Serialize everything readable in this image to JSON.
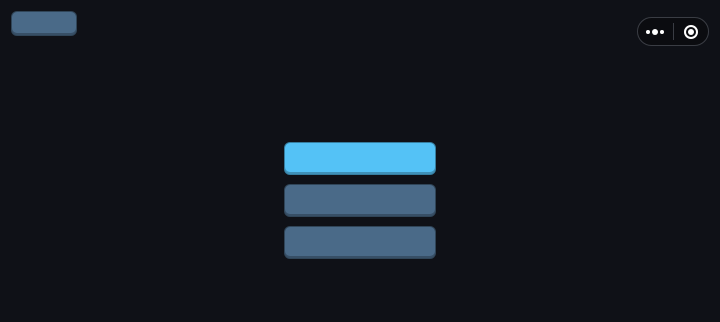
{
  "toolbar": {
    "back_label": ""
  },
  "menu": {
    "items": [
      {
        "label": ""
      },
      {
        "label": ""
      },
      {
        "label": ""
      }
    ]
  },
  "capsule": {
    "more_icon": "more-dots-icon",
    "close_icon": "target-circle-icon"
  },
  "colors": {
    "background": "#0f1117",
    "primary": "#54c2f6",
    "secondary": "#4a6a88",
    "capsule_border": "#3a3d44"
  }
}
